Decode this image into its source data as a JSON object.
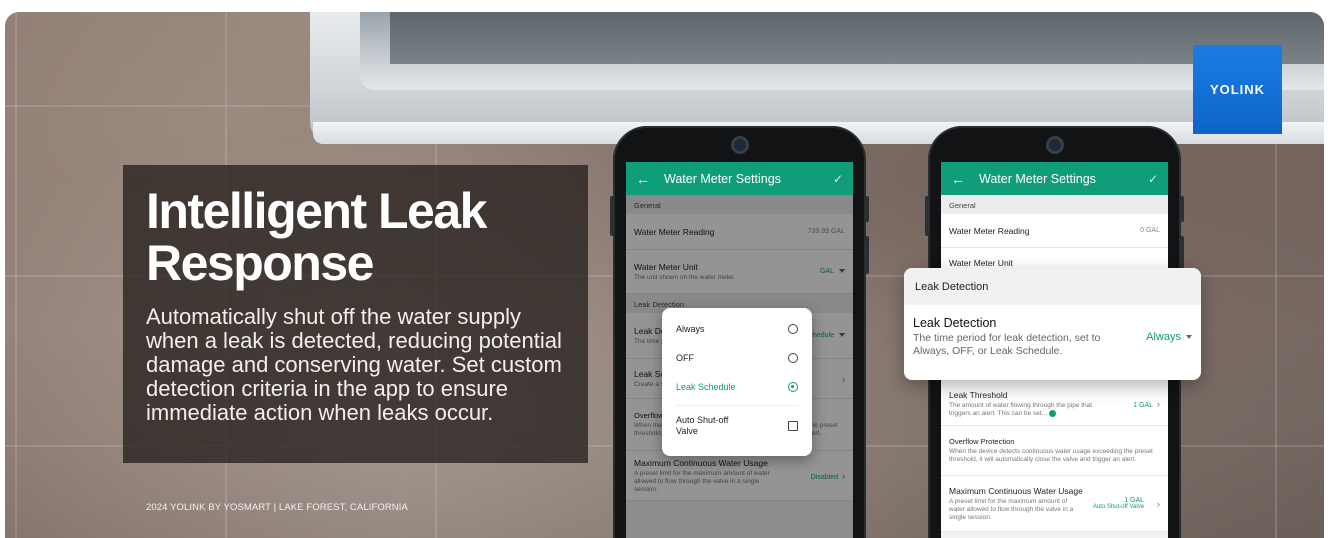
{
  "banner": {
    "headline_line1": "Intelligent Leak",
    "headline_line2": "Response",
    "body": "Automatically shut off the water supply when a leak is detected, reducing potential damage and conserving water. Set custom detection criteria in the app to ensure immediate action when leaks occur.",
    "footer": "2024 YOLINK BY YOSMART  |  LAKE FOREST, CALIFORNIA",
    "logo": "YOLINK"
  },
  "colors": {
    "accent": "#0f9d7a",
    "logo_blue": "#1474d8",
    "panel": "#26201e"
  },
  "icons": {
    "back": "arrow-left-icon",
    "confirm": "check-icon",
    "chevron": "chevron-right-icon",
    "dropdown": "caret-down-icon"
  },
  "phone1": {
    "title": "Water Meter Settings",
    "back": "←",
    "check": "✓",
    "section_general": "General",
    "reading_label": "Water Meter Reading",
    "reading_value": "739.89 GAL",
    "unit_label": "Water Meter Unit",
    "unit_sub": "The unit shown on the water meter.",
    "unit_value": "GAL",
    "section_leak": "Leak Detection",
    "leak_label": "Leak Detection",
    "leak_sub": "The time period for leak detection, set to Always",
    "leak_value": "Schedule",
    "schedule_label": "Leak Schedule",
    "schedule_sub": "Create a schedule",
    "overflow_label": "Overflow Protection",
    "overflow_sub": "When the device detects continuous water usage exceeding the preset threshold, it will automatically close the valve and trigger an alert.",
    "max_label": "Maximum Continuous Water Usage",
    "max_sub": "A preset limit for the maximum amount of water allowed to flow through the valve in a single session.",
    "max_value": "Disabled",
    "popup": {
      "options": [
        "Always",
        "OFF",
        "Leak Schedule"
      ],
      "selected": "Leak Schedule",
      "extra": "Auto Shut-off Valve"
    }
  },
  "phone2": {
    "title": "Water Meter Settings",
    "back": "←",
    "check": "✓",
    "section_general": "General",
    "reading_label": "Water Meter Reading",
    "reading_value": "0 GAL",
    "unit_label": "Water Meter Unit",
    "threshold_label": "Leak Threshold",
    "threshold_sub": "The amount of water flowing through the pipe that triggers an alert. This can be set...",
    "threshold_value": "1 GAL",
    "overflow_label": "Overflow Protection",
    "overflow_sub": "When the device detects continuous water usage exceeding the preset threshold, it will automatically close the valve and trigger an alert.",
    "max_label": "Maximum Continuous Water Usage",
    "max_sub": "A preset limit for the maximum amount of water allowed to flow through the valve in a single session.",
    "max_value": "1 GAL",
    "max_value2": "Auto Shut-off Valve"
  },
  "callout": {
    "header": "Leak Detection",
    "title": "Leak Detection",
    "desc": "The time period for leak detection, set to Always, OFF, or Leak Schedule.",
    "value": "Always"
  }
}
